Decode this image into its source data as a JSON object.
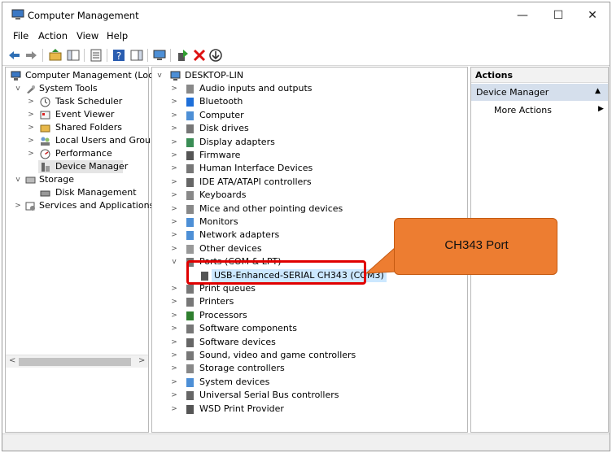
{
  "window": {
    "title": "Computer Management",
    "minimize_glyph": "—",
    "maximize_glyph": "☐",
    "close_glyph": "✕"
  },
  "menu": [
    "File",
    "Action",
    "View",
    "Help"
  ],
  "left_tree": [
    {
      "label": "Computer Management (Local",
      "icon": "computer-management-icon"
    },
    {
      "label": "System Tools",
      "icon": "system-tools-icon"
    },
    {
      "label": "Task Scheduler",
      "icon": "clock-icon"
    },
    {
      "label": "Event Viewer",
      "icon": "event-viewer-icon"
    },
    {
      "label": "Shared Folders",
      "icon": "shared-folder-icon"
    },
    {
      "label": "Local Users and Groups",
      "icon": "users-icon"
    },
    {
      "label": "Performance",
      "icon": "performance-icon"
    },
    {
      "label": "Device Manager",
      "icon": "device-manager-icon"
    },
    {
      "label": "Storage",
      "icon": "storage-icon"
    },
    {
      "label": "Disk Management",
      "icon": "disk-icon"
    },
    {
      "label": "Services and Applications",
      "icon": "services-icon"
    }
  ],
  "device_tree": {
    "root": "DESKTOP-LIN",
    "categories": [
      "Audio inputs and outputs",
      "Bluetooth",
      "Computer",
      "Disk drives",
      "Display adapters",
      "Firmware",
      "Human Interface Devices",
      "IDE ATA/ATAPI controllers",
      "Keyboards",
      "Mice and other pointing devices",
      "Monitors",
      "Network adapters",
      "Other devices",
      "Ports (COM & LPT)",
      "USB-Enhanced-SERIAL CH343 (COM3)",
      "Print queues",
      "Printers",
      "Processors",
      "Software components",
      "Software devices",
      "Sound, video and game controllers",
      "Storage controllers",
      "System devices",
      "Universal Serial Bus controllers",
      "WSD Print Provider"
    ]
  },
  "actions": {
    "header": "Actions",
    "section": "Device Manager",
    "more": "More Actions"
  },
  "callout": {
    "text": "CH343 Port"
  },
  "colors": {
    "callout": "#ed7d31",
    "highlight": "#e00000",
    "selection": "#cce8ff"
  }
}
